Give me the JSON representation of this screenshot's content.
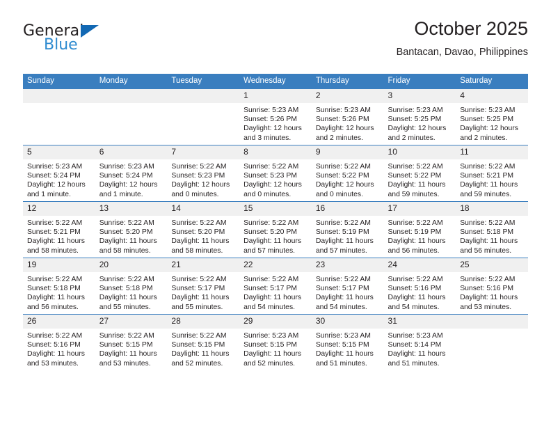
{
  "brand": {
    "name_part1": "General",
    "name_part2": "Blue",
    "accent_color": "#1268b3",
    "accent_color_light": "#2e8bd0"
  },
  "header": {
    "title": "October 2025",
    "subtitle": "Bantacan, Davao, Philippines"
  },
  "theme": {
    "header_row_color": "#3a7ebf",
    "daynum_bg": "#f0f0f0",
    "text_color": "#231f20"
  },
  "calendar": {
    "weekday_headers": [
      "Sunday",
      "Monday",
      "Tuesday",
      "Wednesday",
      "Thursday",
      "Friday",
      "Saturday"
    ],
    "weeks": [
      [
        {
          "day": "",
          "empty": true
        },
        {
          "day": "",
          "empty": true
        },
        {
          "day": "",
          "empty": true
        },
        {
          "day": "1",
          "sunrise": "Sunrise: 5:23 AM",
          "sunset": "Sunset: 5:26 PM",
          "daylight": "Daylight: 12 hours and 3 minutes."
        },
        {
          "day": "2",
          "sunrise": "Sunrise: 5:23 AM",
          "sunset": "Sunset: 5:26 PM",
          "daylight": "Daylight: 12 hours and 2 minutes."
        },
        {
          "day": "3",
          "sunrise": "Sunrise: 5:23 AM",
          "sunset": "Sunset: 5:25 PM",
          "daylight": "Daylight: 12 hours and 2 minutes."
        },
        {
          "day": "4",
          "sunrise": "Sunrise: 5:23 AM",
          "sunset": "Sunset: 5:25 PM",
          "daylight": "Daylight: 12 hours and 2 minutes."
        }
      ],
      [
        {
          "day": "5",
          "sunrise": "Sunrise: 5:23 AM",
          "sunset": "Sunset: 5:24 PM",
          "daylight": "Daylight: 12 hours and 1 minute."
        },
        {
          "day": "6",
          "sunrise": "Sunrise: 5:23 AM",
          "sunset": "Sunset: 5:24 PM",
          "daylight": "Daylight: 12 hours and 1 minute."
        },
        {
          "day": "7",
          "sunrise": "Sunrise: 5:22 AM",
          "sunset": "Sunset: 5:23 PM",
          "daylight": "Daylight: 12 hours and 0 minutes."
        },
        {
          "day": "8",
          "sunrise": "Sunrise: 5:22 AM",
          "sunset": "Sunset: 5:23 PM",
          "daylight": "Daylight: 12 hours and 0 minutes."
        },
        {
          "day": "9",
          "sunrise": "Sunrise: 5:22 AM",
          "sunset": "Sunset: 5:22 PM",
          "daylight": "Daylight: 12 hours and 0 minutes."
        },
        {
          "day": "10",
          "sunrise": "Sunrise: 5:22 AM",
          "sunset": "Sunset: 5:22 PM",
          "daylight": "Daylight: 11 hours and 59 minutes."
        },
        {
          "day": "11",
          "sunrise": "Sunrise: 5:22 AM",
          "sunset": "Sunset: 5:21 PM",
          "daylight": "Daylight: 11 hours and 59 minutes."
        }
      ],
      [
        {
          "day": "12",
          "sunrise": "Sunrise: 5:22 AM",
          "sunset": "Sunset: 5:21 PM",
          "daylight": "Daylight: 11 hours and 58 minutes."
        },
        {
          "day": "13",
          "sunrise": "Sunrise: 5:22 AM",
          "sunset": "Sunset: 5:20 PM",
          "daylight": "Daylight: 11 hours and 58 minutes."
        },
        {
          "day": "14",
          "sunrise": "Sunrise: 5:22 AM",
          "sunset": "Sunset: 5:20 PM",
          "daylight": "Daylight: 11 hours and 58 minutes."
        },
        {
          "day": "15",
          "sunrise": "Sunrise: 5:22 AM",
          "sunset": "Sunset: 5:20 PM",
          "daylight": "Daylight: 11 hours and 57 minutes."
        },
        {
          "day": "16",
          "sunrise": "Sunrise: 5:22 AM",
          "sunset": "Sunset: 5:19 PM",
          "daylight": "Daylight: 11 hours and 57 minutes."
        },
        {
          "day": "17",
          "sunrise": "Sunrise: 5:22 AM",
          "sunset": "Sunset: 5:19 PM",
          "daylight": "Daylight: 11 hours and 56 minutes."
        },
        {
          "day": "18",
          "sunrise": "Sunrise: 5:22 AM",
          "sunset": "Sunset: 5:18 PM",
          "daylight": "Daylight: 11 hours and 56 minutes."
        }
      ],
      [
        {
          "day": "19",
          "sunrise": "Sunrise: 5:22 AM",
          "sunset": "Sunset: 5:18 PM",
          "daylight": "Daylight: 11 hours and 56 minutes."
        },
        {
          "day": "20",
          "sunrise": "Sunrise: 5:22 AM",
          "sunset": "Sunset: 5:18 PM",
          "daylight": "Daylight: 11 hours and 55 minutes."
        },
        {
          "day": "21",
          "sunrise": "Sunrise: 5:22 AM",
          "sunset": "Sunset: 5:17 PM",
          "daylight": "Daylight: 11 hours and 55 minutes."
        },
        {
          "day": "22",
          "sunrise": "Sunrise: 5:22 AM",
          "sunset": "Sunset: 5:17 PM",
          "daylight": "Daylight: 11 hours and 54 minutes."
        },
        {
          "day": "23",
          "sunrise": "Sunrise: 5:22 AM",
          "sunset": "Sunset: 5:17 PM",
          "daylight": "Daylight: 11 hours and 54 minutes."
        },
        {
          "day": "24",
          "sunrise": "Sunrise: 5:22 AM",
          "sunset": "Sunset: 5:16 PM",
          "daylight": "Daylight: 11 hours and 54 minutes."
        },
        {
          "day": "25",
          "sunrise": "Sunrise: 5:22 AM",
          "sunset": "Sunset: 5:16 PM",
          "daylight": "Daylight: 11 hours and 53 minutes."
        }
      ],
      [
        {
          "day": "26",
          "sunrise": "Sunrise: 5:22 AM",
          "sunset": "Sunset: 5:16 PM",
          "daylight": "Daylight: 11 hours and 53 minutes."
        },
        {
          "day": "27",
          "sunrise": "Sunrise: 5:22 AM",
          "sunset": "Sunset: 5:15 PM",
          "daylight": "Daylight: 11 hours and 53 minutes."
        },
        {
          "day": "28",
          "sunrise": "Sunrise: 5:22 AM",
          "sunset": "Sunset: 5:15 PM",
          "daylight": "Daylight: 11 hours and 52 minutes."
        },
        {
          "day": "29",
          "sunrise": "Sunrise: 5:23 AM",
          "sunset": "Sunset: 5:15 PM",
          "daylight": "Daylight: 11 hours and 52 minutes."
        },
        {
          "day": "30",
          "sunrise": "Sunrise: 5:23 AM",
          "sunset": "Sunset: 5:15 PM",
          "daylight": "Daylight: 11 hours and 51 minutes."
        },
        {
          "day": "31",
          "sunrise": "Sunrise: 5:23 AM",
          "sunset": "Sunset: 5:14 PM",
          "daylight": "Daylight: 11 hours and 51 minutes."
        },
        {
          "day": "",
          "empty": true
        }
      ]
    ]
  }
}
